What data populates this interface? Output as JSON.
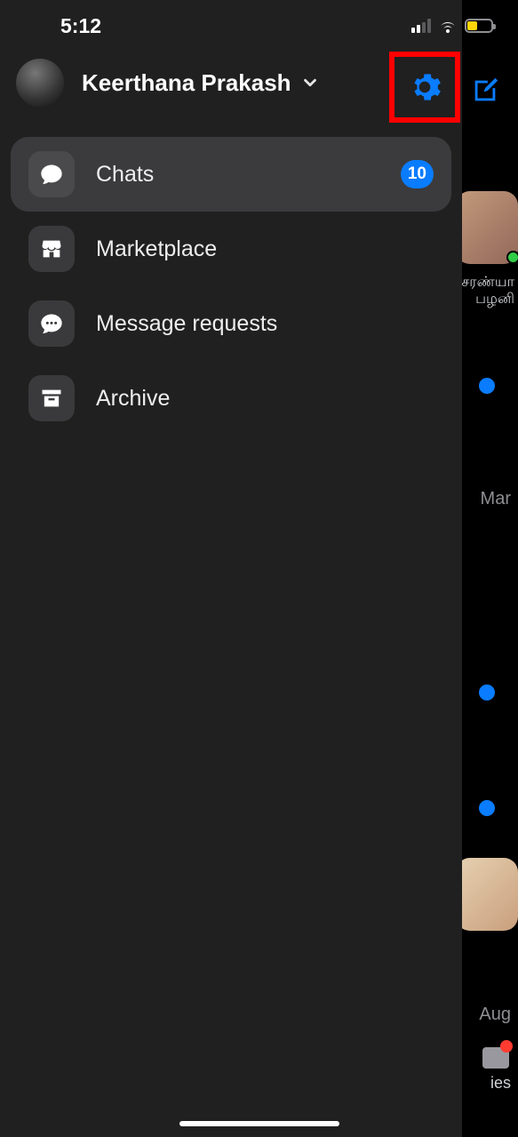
{
  "status": {
    "time": "5:12"
  },
  "header": {
    "username": "Keerthana Prakash"
  },
  "menu": {
    "chats": {
      "label": "Chats",
      "badge": "10"
    },
    "marketplace": {
      "label": "Marketplace"
    },
    "message_requests": {
      "label": "Message requests"
    },
    "archive": {
      "label": "Archive"
    }
  },
  "background": {
    "story_name": "சரண்யா\nபழனி",
    "date1": "Mar",
    "date2": "Aug",
    "tab_frag": "ies"
  }
}
